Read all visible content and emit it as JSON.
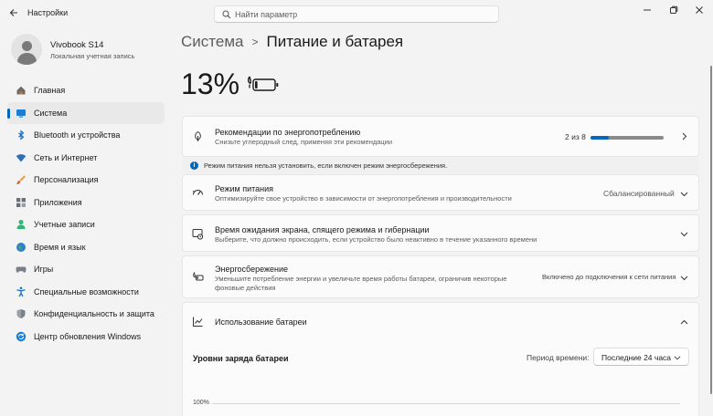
{
  "window": {
    "title": "Настройки",
    "search_placeholder": "Найти параметр"
  },
  "profile": {
    "name": "Vivobook S14",
    "account_type": "Локальная учетная запись"
  },
  "sidebar": {
    "items": [
      {
        "label": "Главная",
        "icon": "home-icon"
      },
      {
        "label": "Система",
        "icon": "system-icon",
        "active": true
      },
      {
        "label": "Bluetooth и устройства",
        "icon": "bluetooth-icon"
      },
      {
        "label": "Сеть и Интернет",
        "icon": "wifi-icon"
      },
      {
        "label": "Персонализация",
        "icon": "brush-icon"
      },
      {
        "label": "Приложения",
        "icon": "apps-icon"
      },
      {
        "label": "Учетные записи",
        "icon": "accounts-icon"
      },
      {
        "label": "Время и язык",
        "icon": "globe-icon"
      },
      {
        "label": "Игры",
        "icon": "gamepad-icon"
      },
      {
        "label": "Специальные возможности",
        "icon": "accessibility-icon"
      },
      {
        "label": "Конфиденциальность и защита",
        "icon": "shield-icon"
      },
      {
        "label": "Центр обновления Windows",
        "icon": "update-icon"
      }
    ]
  },
  "breadcrumb": {
    "parent": "Система",
    "separator": ">",
    "current": "Питание и батарея"
  },
  "battery": {
    "percent_text": "13%",
    "level": 0.13
  },
  "recommendations": {
    "title": "Рекомендации по энергопотреблению",
    "subtitle": "Снизьте углеродный след, применяя эти рекомендации",
    "count_text": "2 из 8",
    "progress": 0.25
  },
  "info_bar": {
    "text": "Режим питания нельзя установить, если включен режим энергосбережения."
  },
  "power_mode": {
    "title": "Режим питания",
    "subtitle": "Оптимизируйте свое устройство в зависимости от энергопотребления и производительности",
    "value": "Сбалансированный"
  },
  "screen_sleep": {
    "title": "Время ожидания экрана, спящего режима и гибернации",
    "subtitle": "Выберите, что должно происходить, если устройство было неактивно в течение указанного времени"
  },
  "energy_saver": {
    "title": "Энергосбережение",
    "subtitle": "Уменьшите потребление энергии и увеличьте время работы батареи, ограничив некоторые фоновые действия",
    "value": "Включено до подключения к сети питания"
  },
  "battery_usage": {
    "title": "Использование батареи",
    "levels_title": "Уровни заряда батареи",
    "period_label": "Период времени:",
    "period_value": "Последние 24 часа",
    "axis_top_label": "100%"
  },
  "colors": {
    "accent": "#0067c0",
    "background": "#f3f3f3",
    "card": "#fbfbfb"
  }
}
